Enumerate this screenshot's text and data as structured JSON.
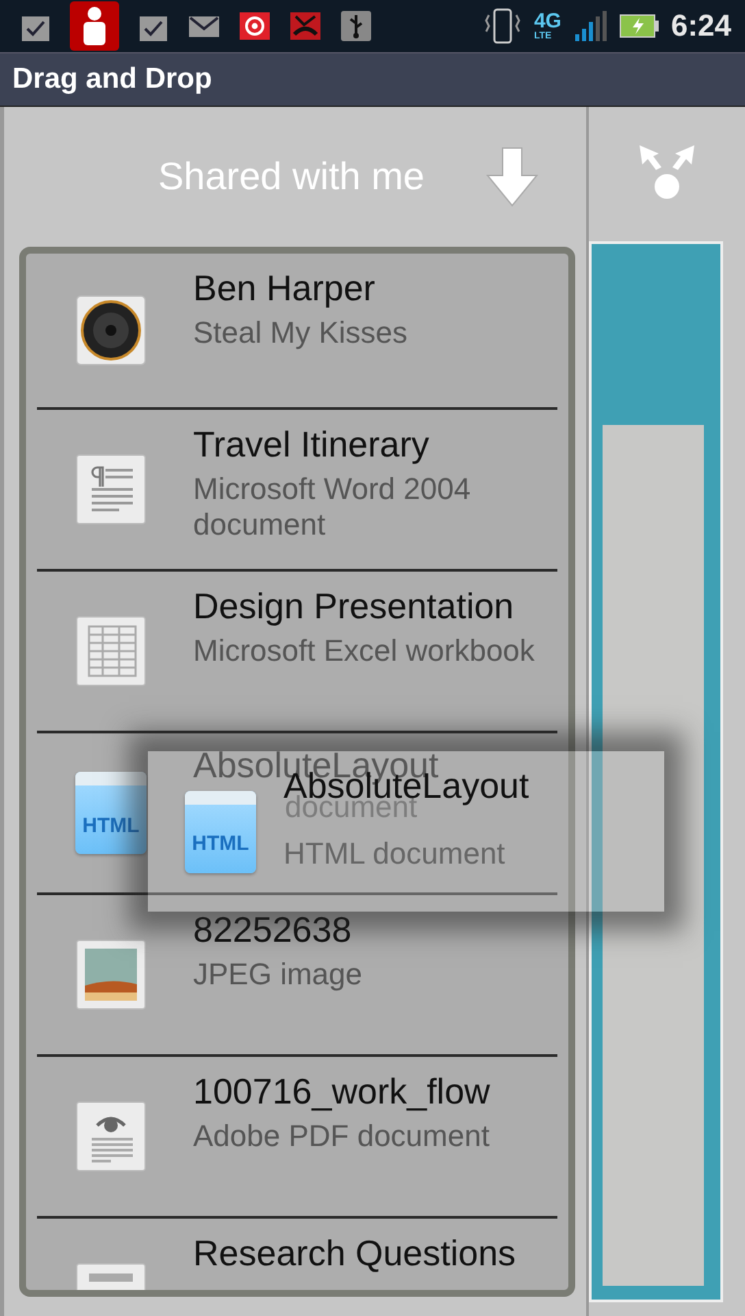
{
  "status_bar": {
    "network": "4G",
    "network_sub": "LTE",
    "time": "6:24"
  },
  "window": {
    "title": "Drag and Drop"
  },
  "panel": {
    "title": "Shared with me"
  },
  "files": [
    {
      "kind": "audio",
      "name": "Ben Harper",
      "type": "Steal My Kisses"
    },
    {
      "kind": "word",
      "name": "Travel Itinerary",
      "type": "Microsoft Word 2004 document"
    },
    {
      "kind": "sheet",
      "name": "Design Presentation",
      "type": "Microsoft Excel workbook"
    },
    {
      "kind": "html",
      "name": "AbsoluteLayout",
      "type": "document",
      "icon_text": "HTML"
    },
    {
      "kind": "image",
      "name": "82252638",
      "type": "JPEG image"
    },
    {
      "kind": "pdf",
      "name": "100716_work_flow",
      "type": "Adobe PDF document"
    },
    {
      "kind": "doc",
      "name": "Research Questions"
    }
  ],
  "drag_item": {
    "kind": "html",
    "name": "AbsoluteLayout",
    "type": "HTML document",
    "icon_text": "HTML"
  }
}
